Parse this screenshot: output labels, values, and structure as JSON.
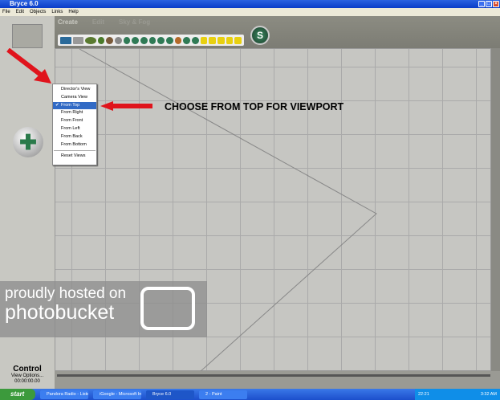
{
  "window": {
    "title": "Bryce 6.0"
  },
  "menu": [
    "File",
    "Edit",
    "Objects",
    "Links",
    "Help"
  ],
  "palette_tabs": [
    "Create",
    "Edit",
    "Sky & Fog"
  ],
  "logo": "S",
  "view_menu": {
    "items": [
      "Director's View",
      "Camera View",
      "From Top",
      "From Right",
      "From Front",
      "From Left",
      "From Back",
      "From Bottom"
    ],
    "selected": "From Top",
    "reset": "Reset Views",
    "check": "✔"
  },
  "annotation": "CHOOSE FROM TOP FOR VIEWPORT",
  "control": {
    "title": "Control",
    "view_options": "View Options...",
    "time": "00:00:00.00"
  },
  "watermark": {
    "line1": "proudly hosted on",
    "line2": "photobucket"
  },
  "taskbar": {
    "start": "start",
    "tasks": [
      "Pandora Radio - Liste...",
      "iGoogle - Microsoft In...",
      "Bryce 6.0",
      "2 - Paint"
    ],
    "tray_time": "22:21",
    "clock": "3:32 AM"
  },
  "colors": {
    "accent": "#316ac5",
    "arrow": "#e0141c"
  }
}
